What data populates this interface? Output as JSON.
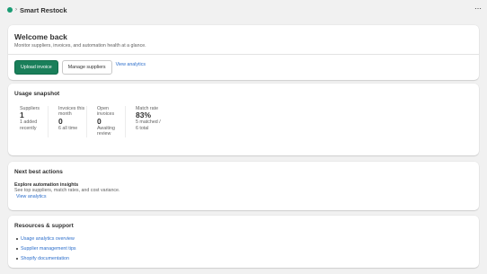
{
  "header": {
    "app_icon": "app-icon",
    "app_title": "Smart Restock",
    "more_label": "⋯"
  },
  "welcome": {
    "title": "Welcome back",
    "subtitle": "Monitor suppliers, invoices, and automation health at a glance.",
    "upload_label": "Upload invoice",
    "manage_label": "Manage suppliers",
    "analytics_label": "View analytics"
  },
  "usage": {
    "title": "Usage snapshot",
    "stats": [
      {
        "label": "Suppliers",
        "value": "1",
        "sub": "1 added recently"
      },
      {
        "label": "Invoices this month",
        "value": "0",
        "sub": "6 all time"
      },
      {
        "label": "Open invoices",
        "value": "0",
        "sub": "Awaiting review"
      },
      {
        "label": "Match rate",
        "value": "83%",
        "sub": "5 matched / 6 total"
      }
    ]
  },
  "actions": {
    "title": "Next best actions",
    "item_title": "Explore automation insights",
    "item_desc": "See top suppliers, match rates, and cost variance.",
    "item_link": "View analytics"
  },
  "resources": {
    "title": "Resources & support",
    "links": [
      "Usage analytics overview",
      "Supplier management tips",
      "Shopify documentation"
    ]
  },
  "colors": {
    "primary": "#1a7f5a",
    "link": "#2c6ecb",
    "background": "#f1f1f1"
  }
}
